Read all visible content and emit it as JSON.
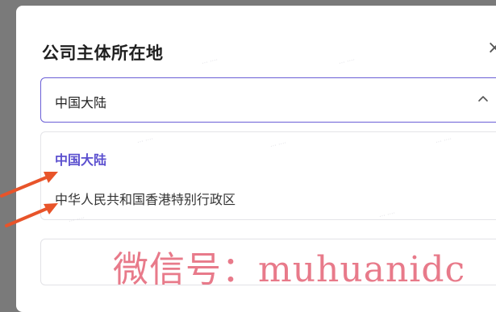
{
  "modal": {
    "title": "公司主体所在地",
    "close_glyph": "×"
  },
  "select": {
    "value": "中国大陆",
    "icon": "chevron-up-icon",
    "border_color": "#6b5fd6"
  },
  "dropdown": {
    "options": [
      {
        "label": "中国大陆",
        "selected": true
      },
      {
        "label": "中华人民共和国香港特别行政区",
        "selected": false
      }
    ]
  },
  "annotation": {
    "arrow_color": "#e8542a",
    "overlay_text": "微信号：muhuanidc"
  },
  "colors": {
    "accent": "#5b4fcf",
    "backdrop": "#7a7a7a"
  }
}
